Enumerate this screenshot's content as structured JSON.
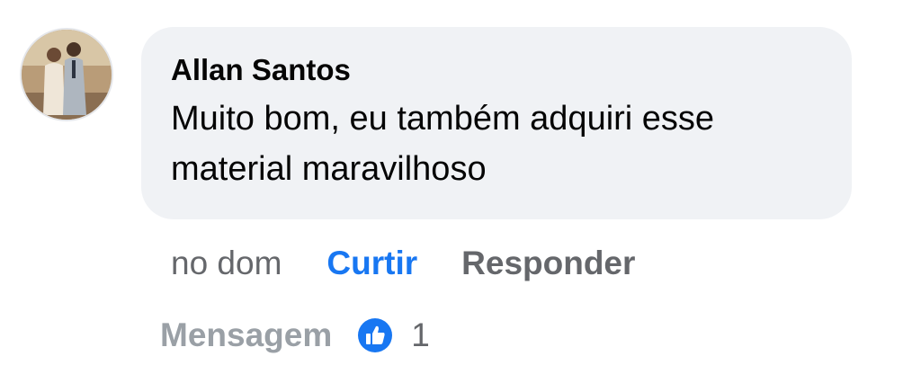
{
  "comment": {
    "author": "Allan Santos",
    "text": "Muito bom, eu também adquiri esse material maravilhoso",
    "timestamp": "no dom",
    "like_label": "Curtir",
    "reply_label": "Responder",
    "message_label": "Mensagem",
    "reaction_count": "1",
    "reaction_icon": "thumbs-up-icon"
  },
  "colors": {
    "bubble_bg": "#f0f2f5",
    "like_blue": "#1877f2",
    "secondary_text": "#65676b",
    "muted_text": "#9aa0a6"
  }
}
